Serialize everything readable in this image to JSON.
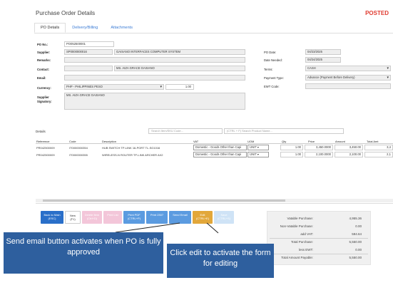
{
  "page": {
    "title": "Purchase Order Details",
    "status": "POSTED"
  },
  "tabs": [
    {
      "label": "PO Details"
    },
    {
      "label": "Delivery/Billing"
    },
    {
      "label": "Attachments"
    }
  ],
  "form": {
    "po_no_label": "PO No.:",
    "po_no": "PO052500001",
    "supplier_label": "Supplier:",
    "supplier_code": "SP0000000016",
    "supplier_name": "GAISANO INTERFACES COMPUTER SYSTEM",
    "remarks_label": "Remarks:",
    "remarks": "",
    "contact_label": "Contact:",
    "contact": "MS. AIZA GRACE GAISANO",
    "email_label": "Email:",
    "email": "",
    "currency_label": "Currency:",
    "currency": "PHP - PHILIPPINES PESO",
    "rate": "1.00",
    "signatory_label": "Supplier Signatory:",
    "signatory": "MS. AIZA GRACE GAISANO",
    "po_date_label": "PO Date:",
    "po_date": "04/23/2025",
    "date_needed_label": "Date Needed:",
    "date_needed": "04/24/2025",
    "terms_label": "Terms:",
    "terms": "CASH",
    "payment_type_label": "Payment Type:",
    "payment_type": "Advance (Payment Before Delivery)",
    "ewt_label": "EWT Code:",
    "ewt_code": ""
  },
  "details": {
    "title": "Details",
    "search_item_placeholder": "Search Item/SKU Code...",
    "search_product_placeholder": "(CTRL + F) Search Product Name...",
    "columns": [
      "Reference",
      "Code",
      "Description",
      "VAT",
      "UOM",
      "Qty",
      "Price",
      "Amount",
      "Total Amt"
    ],
    "rows": [
      {
        "reference": "PR042500009",
        "code": "IT0000000354",
        "description": "HUB SWITCH TP-LINK 16-PORT TL-SG1016",
        "vat": "Domestic - Goods Other than Capi",
        "uom": "UNIT",
        "qty": "1.00",
        "price": "3,450.0000",
        "amount": "3,450.00",
        "total": "3,4"
      },
      {
        "reference": "PR042500009",
        "code": "IT0000000355",
        "description": "WIRELESS-N ROUTER TP-LINK ARCHER AX2",
        "vat": "Domestic - Goods Other than Capi",
        "uom": "UNIT",
        "qty": "1.00",
        "price": "2,100.0000",
        "amount": "2,100.00",
        "total": "2,1"
      }
    ]
  },
  "buttons": {
    "back_line1": "Back to Main",
    "back_line2": "(ESC)",
    "new_line1": "New",
    "new_line2": "(F1)",
    "delete_line1": "Delete Item",
    "delete_line2": "(Ctrl+D)",
    "print_label": "Print List",
    "print_pdf_line1": "Print PDF",
    "print_pdf_line2": "(CTRL+P)",
    "print_2307_label": "Print 2307",
    "send_email_label": "Send Email",
    "edit_line1": "Edit",
    "edit_line2": "(CTRL+E)",
    "save_line1": "Save",
    "save_line2": "(CTRL+S)"
  },
  "summary": {
    "vatable_label": "Vatable Purchase:",
    "vatable": "4,955.36",
    "nonvatable_label": "Non-Vatable Purchase:",
    "nonvatable": "0.00",
    "addvat_label": "add VAT:",
    "addvat": "594.64",
    "total_label": "Total Purchase:",
    "total": "5,550.00",
    "ewt_label": "less EWT:",
    "ewt": "0.00",
    "payable_label": "Total Amount Payable:",
    "payable": "5,550.00"
  },
  "callouts": {
    "send_email": "Send email button activates when PO is fully approved",
    "edit": "Click edit to activate the form for editing"
  },
  "colors": {
    "status": "#e03c31",
    "primary_button": "#2a6fc9",
    "edit_button": "#e2a73a",
    "callout": "#2e5f9e"
  }
}
